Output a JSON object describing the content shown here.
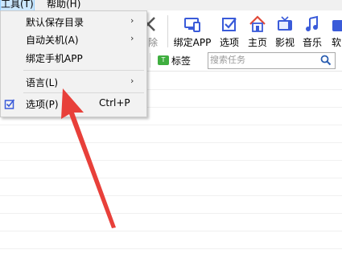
{
  "menubar": {
    "tools": "工具(T)",
    "help": "帮助(H)"
  },
  "toolbar": {
    "delete": "删除",
    "bind_app": "绑定APP",
    "options": "选项",
    "home": "主页",
    "video": "影视",
    "music": "音乐",
    "software": "软"
  },
  "filterbar": {
    "tag": "标签",
    "search_placeholder": "搜索任务"
  },
  "tools_menu": {
    "items": [
      {
        "label": "默认保存目录",
        "has_submenu": true
      },
      {
        "label": "自动关机(A)",
        "has_submenu": true
      },
      {
        "label": "绑定手机APP",
        "has_submenu": false
      },
      {
        "label": "语言(L)",
        "has_submenu": true
      },
      {
        "label": "选项(P)",
        "shortcut": "Ctrl+P",
        "icon": "options-icon"
      }
    ],
    "submenu_arrow": "›"
  },
  "annotation": {
    "color": "#e8403a",
    "icon": "red-arrow-pointer"
  },
  "colors": {
    "menu_highlight": "#cce8ff",
    "toolbar_icon_blue": "#3a5bd9",
    "home_icon_red": "#e04a3a"
  }
}
